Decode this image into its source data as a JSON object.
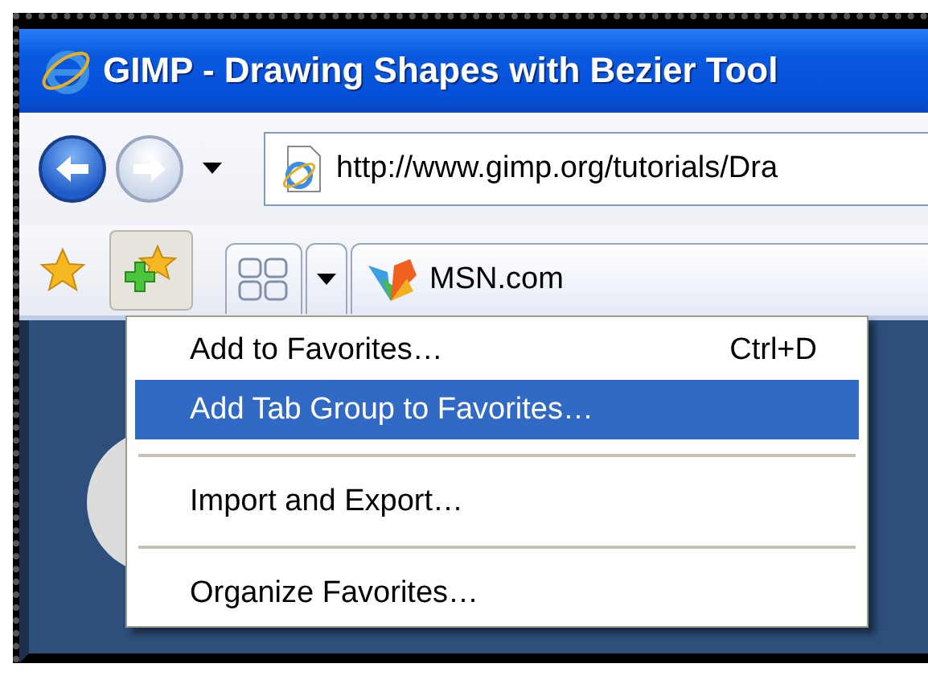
{
  "window": {
    "title": "GIMP - Drawing Shapes with Bezier Tool"
  },
  "address_bar": {
    "value": "http://www.gimp.org/tutorials/Dra"
  },
  "tabs": [
    {
      "label": "MSN.com",
      "selected": true
    }
  ],
  "favorites_menu": {
    "groups": [
      [
        {
          "label": "Add to Favorites…",
          "shortcut": "Ctrl+D",
          "selected": false
        },
        {
          "label": "Add Tab Group to Favorites…",
          "selected": true
        }
      ],
      [
        {
          "label": "Import and Export…",
          "selected": false
        }
      ],
      [
        {
          "label": "Organize Favorites…",
          "selected": false
        }
      ]
    ]
  }
}
